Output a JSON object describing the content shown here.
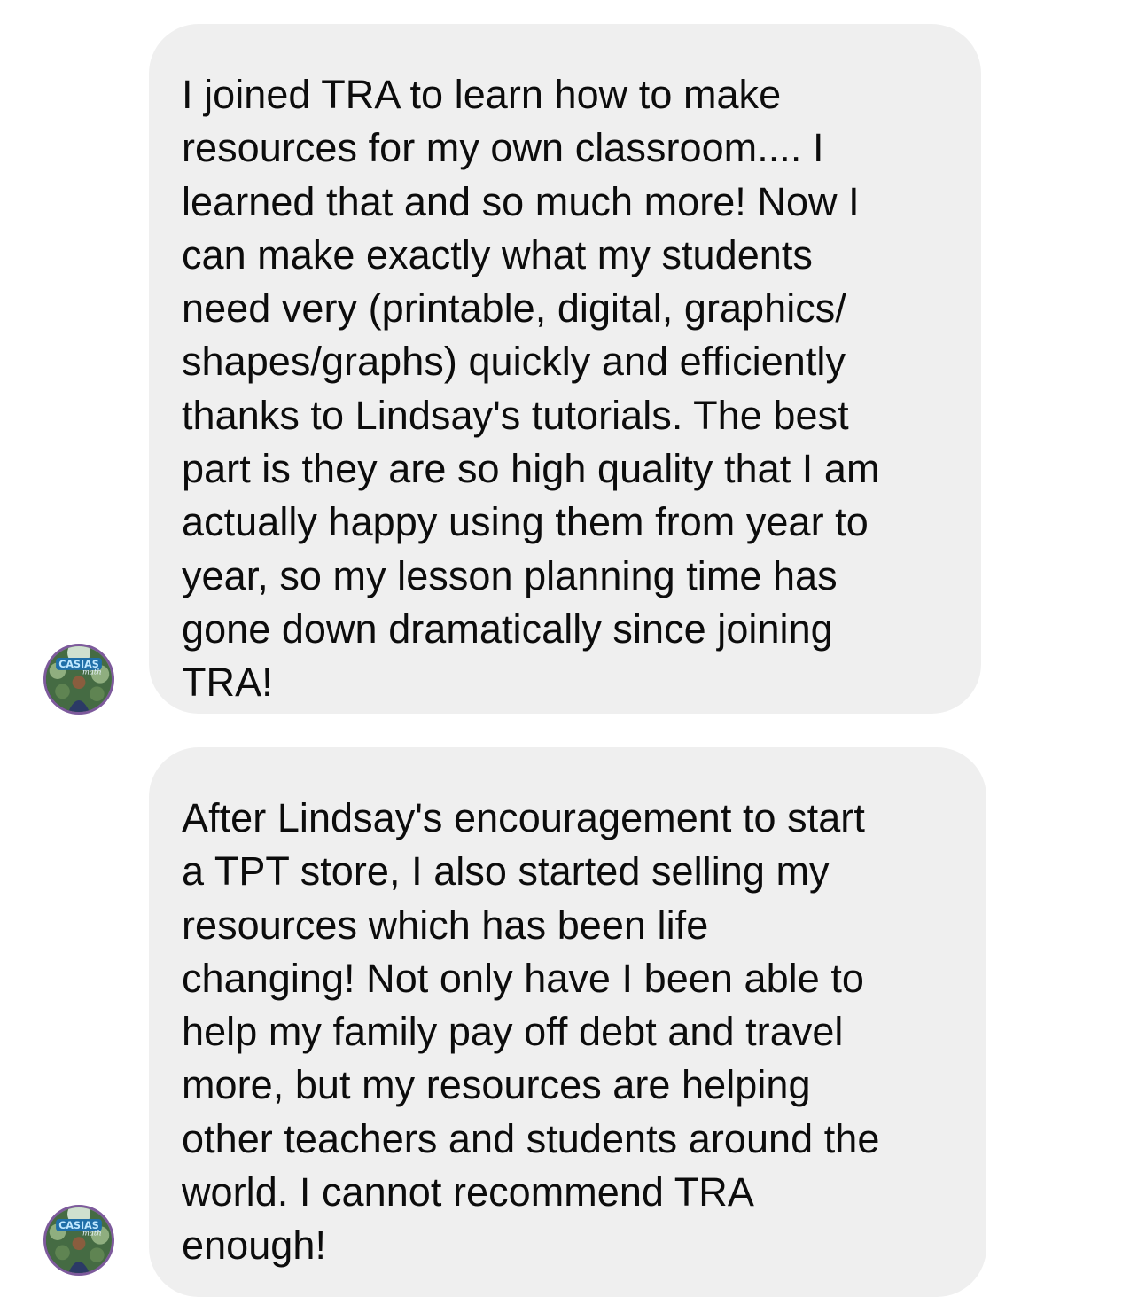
{
  "messages": [
    {
      "sender_avatar": "casias-math-avatar",
      "text": "I joined TRA to learn how to make\nresources for my own classroom.... I\nlearned that and so much more! Now I\ncan make exactly what my students\nneed very (printable, digital, graphics/\nshapes/graphs) quickly and efficiently\nthanks to Lindsay's tutorials. The best\npart is they are so high quality that I am\nactually happy using them from year to\nyear, so my lesson planning time has\ngone down dramatically since joining\nTRA!"
    },
    {
      "sender_avatar": "casias-math-avatar",
      "text": "After Lindsay's encouragement to start\na TPT store, I also started selling my\nresources which has been life\nchanging! Not only have I been able to\nhelp my family pay off debt and travel\nmore, but my resources are helping\nother teachers and students around the\nworld. I cannot recommend TRA\nenough!"
    }
  ],
  "avatar": {
    "logo_text": "CASIAS",
    "logo_subtext": "math",
    "border_color": "#7d5a9c"
  },
  "colors": {
    "bubble_background": "#efefef",
    "text": "#0c0c0c",
    "page_background": "#ffffff"
  }
}
